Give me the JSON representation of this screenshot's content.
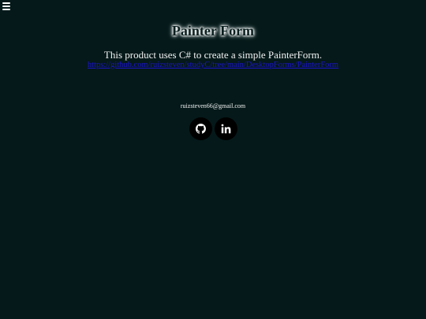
{
  "header": {
    "menu_icon": "hamburger-menu-icon"
  },
  "main": {
    "title": "Painter Form",
    "description": "This product uses C# to create a simple PainterForm.",
    "link_text": "https://github.com/ruizsteven/studyC/tree/main/DesktopForms/PainterForm",
    "link_color": "#1a14c9"
  },
  "footer": {
    "email": "ruizsteven66@gmail.com",
    "social": [
      {
        "name": "github",
        "icon": "github-icon"
      },
      {
        "name": "linkedin",
        "icon": "linkedin-icon"
      }
    ]
  },
  "colors": {
    "background": "#05191a",
    "text": "#ffffff",
    "social_button": "#000000"
  }
}
